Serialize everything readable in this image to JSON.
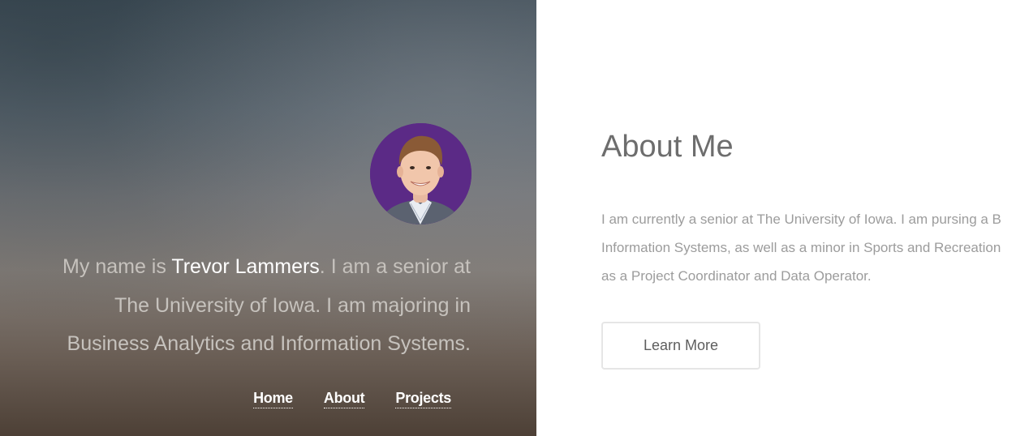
{
  "hero": {
    "intro_prefix": "My name is ",
    "intro_name": "Trevor Lammers",
    "intro_suffix": ". I am a senior at The University of Iowa. I am majoring in Business Analytics and Information Systems.",
    "nav": {
      "home": "Home",
      "about": "About",
      "projects": "Projects"
    }
  },
  "about": {
    "title": "About Me",
    "body_lines": [
      "I am currently a senior at The University of Iowa. I am pursing a B",
      "Information Systems, as well as a minor in Sports and Recreation",
      "as a Project Coordinator and Data Operator."
    ],
    "button_label": "Learn More"
  },
  "colors": {
    "avatar_background": "#5b2a86",
    "name_highlight": "#ffffff",
    "heading": "#6d6d6d",
    "body_text": "#9c9c9c"
  }
}
